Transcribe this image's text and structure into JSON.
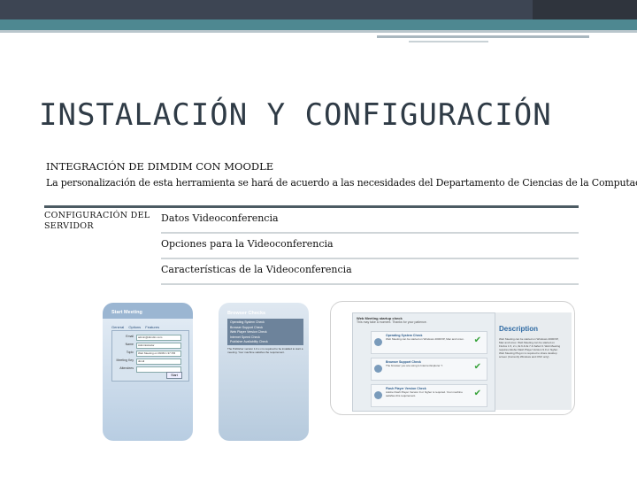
{
  "header": {
    "title": "INSTALACIÓN Y CONFIGURACIÓN",
    "subtitle": "INTEGRACIÓN DE DIMDIM CON MOODLE",
    "description": "La personalización de esta herramienta se hará de acuerdo a las necesidades del Departamento de Ciencias de la Computación."
  },
  "table": {
    "left_label": "CONFIGURACIÓN DEL SERVIDOR",
    "rows": [
      {
        "label": "Datos Videoconferencia"
      },
      {
        "label": "Opciones para la Videoconferencia"
      },
      {
        "label": "Características de la Videoconferencia"
      }
    ]
  },
  "screenshots": {
    "start_meeting": {
      "title": "Start Meeting",
      "tabs": [
        "General",
        "Options",
        "Features"
      ],
      "fields": [
        {
          "label": "Email",
          "value": "admin@dimdim.com"
        },
        {
          "label": "Name",
          "value": "Administrador"
        },
        {
          "label": "Topic",
          "value": "Web Meeting on 09/09 1:37 PM"
        },
        {
          "label": "Meeting Key",
          "value": "dimdi"
        },
        {
          "label": "Attendees",
          "value": ""
        }
      ],
      "start_label": "Start"
    },
    "browser_checks": {
      "title": "Browser Checks",
      "items": [
        "Operating System Check",
        "Browser Support Check",
        "Web Player Version Check",
        "Internet Speed Check",
        "Publisher Availability Check"
      ],
      "note": "The Publisher version 1.0.x.x is required to be installed to start a meeting. Your machine satisfies the requirement."
    },
    "meeting_check": {
      "title": "Web Meeting startup check",
      "subtitle": "This may take a moment. Thanks for your patience.",
      "checks": [
        {
          "name": "Operating System Check",
          "desc": "Web Meeting can be started on Windows 2000/XP, Mac and Linux."
        },
        {
          "name": "Browser Support Check",
          "desc": "The browser you are using is Internet Explorer 7."
        },
        {
          "name": "Flash Player Version Check",
          "desc": "Adobe Flash Player Version 9 or higher is required. Your machine satisfies this requirement."
        }
      ],
      "desc_title": "Description",
      "desc_text": "Web Meeting can be started on Windows 2000/XP, Mac and Linux. Web Meeting can be started on Firefox 1.5, 2.x, IE 6 & IE 7 & Safari 3. Web Meeting requires Adobe Flash Player Version 9.0 or higher. Web Meeting Plug-in is required to share desktop screen (Currently Windows and OSX only)."
    }
  }
}
